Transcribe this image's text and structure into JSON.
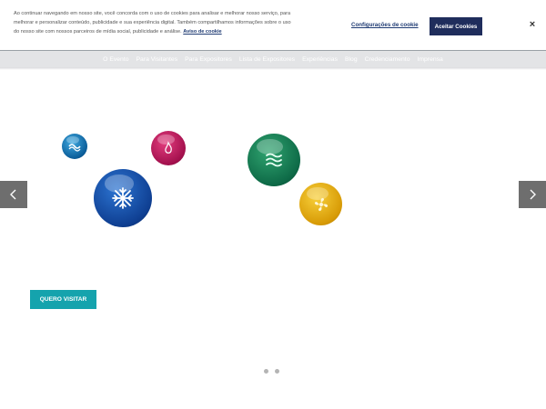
{
  "cookie_banner": {
    "text": "Ao continuar navegando em nosso site, você concorda com o uso de cookies para analisar e melhorar nosso serviço, para melhorar e personalizar conteúdo, publicidade e sua experiência digital. Também compartilhamos informações sobre o uso do nosso site com nossos parceiros de mídia social, publicidade e análise.",
    "policy_link": "Aviso de cookie",
    "settings_label": "Configurações de cookie",
    "accept_label": "Aceitar Cookies",
    "close_label": "×"
  },
  "nav": {
    "items": [
      "O Evento",
      "Para Visitantes",
      "Para Expositores",
      "Lista de Expositores",
      "Experiências",
      "Blog",
      "Credenciamento",
      "Imprensa"
    ]
  },
  "hero": {
    "cta_label": "QUERO VISITAR",
    "orbs": [
      "wave-icon",
      "flame-icon",
      "snowflake-icon",
      "water-icon",
      "fan-icon"
    ],
    "slide_count": 2
  },
  "colors": {
    "accent": "#15a3ad",
    "brand_navy": "#1f2d5c",
    "arrow_bg": "#6e6e6e"
  }
}
